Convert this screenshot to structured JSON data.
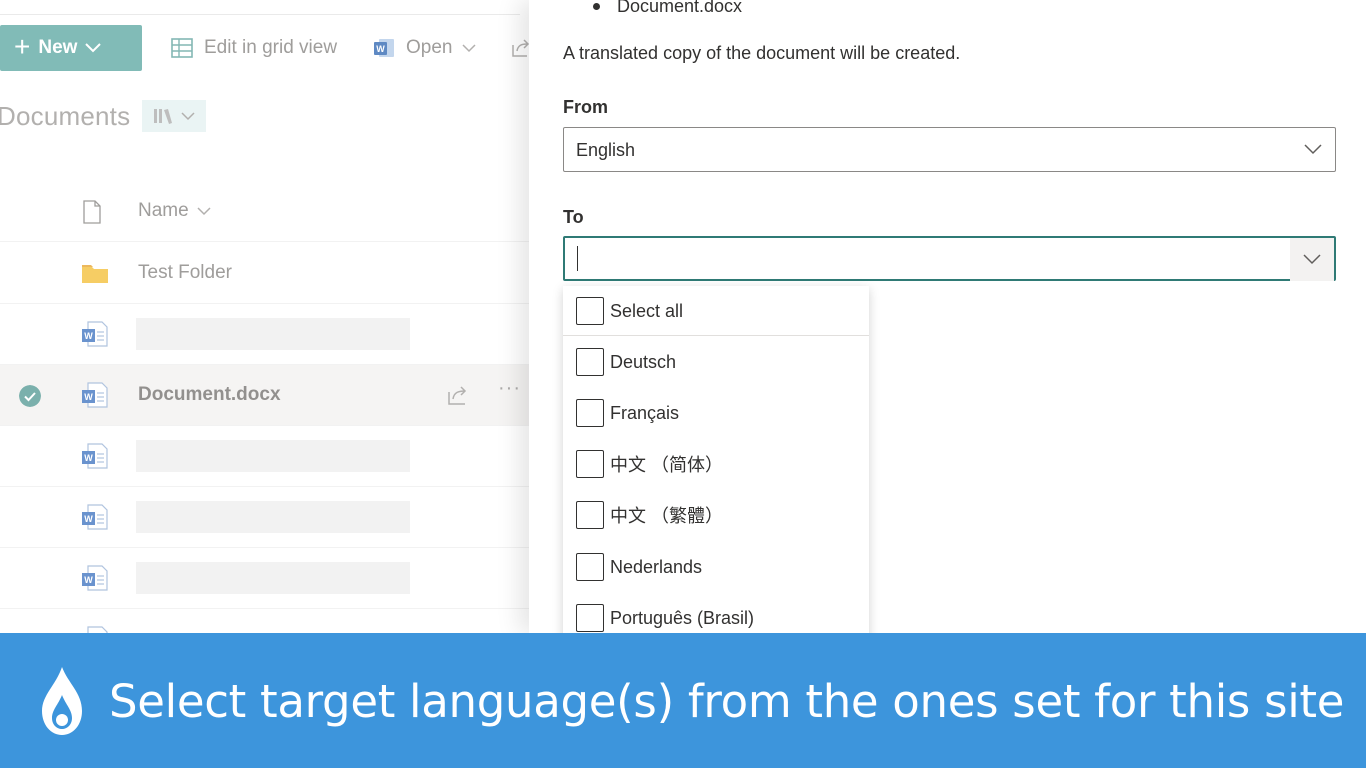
{
  "library": {
    "command_bar": {
      "new_label": "New",
      "edit_grid_label": "Edit in grid view",
      "open_label": "Open"
    },
    "title": "Documents",
    "column_name": "Name",
    "rows": [
      {
        "type": "folder",
        "label": "Test Folder"
      },
      {
        "type": "word",
        "label": ""
      },
      {
        "type": "word",
        "label": "Document.docx",
        "selected": true
      },
      {
        "type": "word",
        "label": ""
      },
      {
        "type": "word",
        "label": ""
      },
      {
        "type": "word",
        "label": ""
      }
    ]
  },
  "panel": {
    "file_bullet": "Document.docx",
    "description": "A translated copy of the document will be created.",
    "from_label": "From",
    "from_value": "English",
    "to_label": "To",
    "to_value": "",
    "options": [
      {
        "label": "Select all",
        "checked": false
      },
      {
        "label": "Deutsch",
        "checked": false
      },
      {
        "label": "Français",
        "checked": false
      },
      {
        "label": "中文 （简体）",
        "checked": false
      },
      {
        "label": "中文 （繁體）",
        "checked": false
      },
      {
        "label": "Nederlands",
        "checked": false
      },
      {
        "label": "Português (Brasil)",
        "checked": false
      }
    ]
  },
  "banner": {
    "caption": "Select target language(s) from the ones set for this site"
  },
  "colors": {
    "accent_teal": "#66aca8",
    "focus_border": "#2f7a75",
    "banner_blue": "#3d95dc"
  }
}
